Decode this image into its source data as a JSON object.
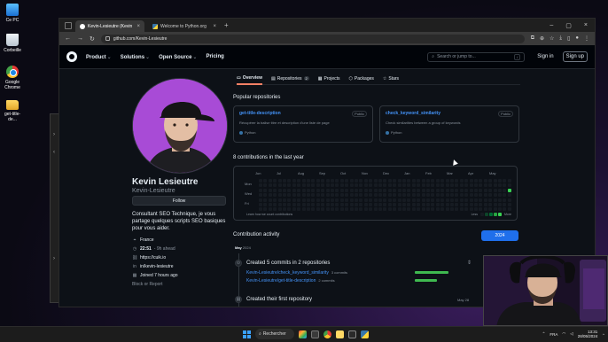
{
  "desktop": {
    "icons": [
      {
        "label": "Ce PC",
        "icon": "computer-icon"
      },
      {
        "label": "Corbeille",
        "icon": "recycle-bin-icon"
      },
      {
        "label": "Google Chrome",
        "icon": "chrome-icon"
      },
      {
        "label": "get-title-de...",
        "icon": "folder-icon"
      }
    ]
  },
  "browser": {
    "tabs": [
      {
        "title": "Kevin-Lesieutre (Kevin Lesieu...",
        "active": true
      },
      {
        "title": "Welcome to Python.org",
        "active": false
      }
    ],
    "url": "github.com/Kevin-Lesieutre"
  },
  "github": {
    "nav": [
      "Product",
      "Solutions",
      "Open Source",
      "Pricing"
    ],
    "search_placeholder": "Search or jump to...",
    "search_key": "/",
    "sign_in": "Sign in",
    "sign_up": "Sign up",
    "tabs": [
      {
        "label": "Overview",
        "selected": true,
        "count": ""
      },
      {
        "label": "Repositories",
        "selected": false,
        "count": "2"
      },
      {
        "label": "Projects",
        "selected": false,
        "count": ""
      },
      {
        "label": "Packages",
        "selected": false,
        "count": ""
      },
      {
        "label": "Stars",
        "selected": false,
        "count": ""
      }
    ]
  },
  "profile": {
    "name": "Kevin Lesieutre",
    "login": "Kevin-Lesieutre",
    "follow": "Follow",
    "bio": "Consultant SEO Technique, je vous partage quelques scripts SEO basiques pour vous aider.",
    "location": "France",
    "time": "22:51",
    "time_note": "- 9h ahead",
    "website": "https://cuik.io",
    "linkedin": "in/kevin-lesieutre",
    "joined": "Joined 7 hours ago",
    "block": "Block or Report"
  },
  "popular": {
    "title": "Popular repositories",
    "repos": [
      {
        "name": "get-title-description",
        "visibility": "Public",
        "description": "Récupérer la balise titre et description d'une liste de page",
        "language": "Python",
        "lang_color": "#3572a5"
      },
      {
        "name": "check_keyword_similarity",
        "visibility": "Public",
        "description": "Check similarities between a group of keywords",
        "language": "Python",
        "lang_color": "#3572a5"
      }
    ]
  },
  "contributions": {
    "title": "8 contributions in the last year",
    "months": [
      "Jun",
      "Jul",
      "Aug",
      "Sep",
      "Oct",
      "Nov",
      "Dec",
      "Jan",
      "Feb",
      "Mar",
      "Apr",
      "May"
    ],
    "days": [
      "Mon",
      "Wed",
      "Fri"
    ],
    "learn": "Learn how we count contributions",
    "less": "Less",
    "more": "More",
    "legend_colors": [
      "#161b22",
      "#0e4429",
      "#006d32",
      "#26a641",
      "#39d353"
    ],
    "active_cell_color": "#39d353"
  },
  "activity": {
    "title": "Contribution activity",
    "year": "2024",
    "month": "May",
    "month_year": "2024",
    "commit_summary": "Created 5 commits in 2 repositories",
    "commit_repos": [
      {
        "name": "Kevin-Lesieutre/check_keyword_similarity",
        "count": "3 commits",
        "share": 1.0
      },
      {
        "name": "Kevin-Lesieutre/get-title-description",
        "count": "2 commits",
        "share": 0.67
      }
    ],
    "first_repo": "Created their first repository",
    "first_repo_date": "May 28"
  },
  "taskbar": {
    "search": "Rechercher",
    "lang": "FRA",
    "time": "13:31",
    "date": "28/05/2024"
  }
}
